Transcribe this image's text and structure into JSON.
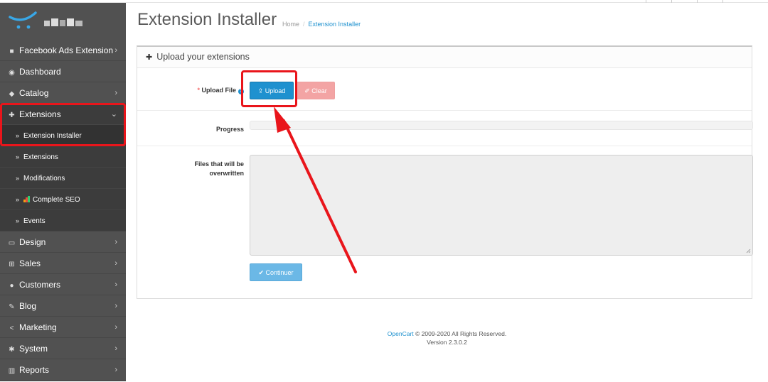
{
  "sidebar": {
    "items": [
      {
        "label": "Facebook Ads Extension",
        "icon": "facebook-icon",
        "chevron": "›"
      },
      {
        "label": "Dashboard",
        "icon": "dashboard-icon",
        "chevron": ""
      },
      {
        "label": "Catalog",
        "icon": "tag-icon",
        "chevron": "›"
      },
      {
        "label": "Extensions",
        "icon": "puzzle-icon",
        "chevron": "⌄"
      },
      {
        "label": "Design",
        "icon": "monitor-icon",
        "chevron": "›"
      },
      {
        "label": "Sales",
        "icon": "cart-icon",
        "chevron": "›"
      },
      {
        "label": "Customers",
        "icon": "user-icon",
        "chevron": "›"
      },
      {
        "label": "Blog",
        "icon": "edit-icon",
        "chevron": "›"
      },
      {
        "label": "Marketing",
        "icon": "share-icon",
        "chevron": "›"
      },
      {
        "label": "System",
        "icon": "gear-icon",
        "chevron": "›"
      },
      {
        "label": "Reports",
        "icon": "bar-chart-icon",
        "chevron": "›"
      }
    ],
    "subitems": [
      {
        "label": "Extension Installer"
      },
      {
        "label": "Extensions"
      },
      {
        "label": "Modifications"
      },
      {
        "label": "Complete SEO"
      },
      {
        "label": "Events"
      }
    ]
  },
  "header": {
    "title": "Extension Installer",
    "breadcrumb": [
      "Home",
      "Extension Installer"
    ]
  },
  "panel": {
    "heading": "Upload your extensions",
    "upload_label": "Upload File",
    "required_mark": "*",
    "upload_button": "Upload",
    "clear_button": "Clear",
    "progress_label": "Progress",
    "progress_value": 0,
    "files_label_line1": "Files that will be",
    "files_label_line2": "overwritten",
    "files_value": "",
    "continue_button": "Continuer"
  },
  "footer": {
    "link": "OpenCart",
    "copyright": " © 2009-2020 All Rights Reserved.",
    "version": "Version 2.3.0.2"
  },
  "colors": {
    "sidebar": "#515151",
    "accent": "#1e91cf",
    "highlight": "#e9151b"
  }
}
